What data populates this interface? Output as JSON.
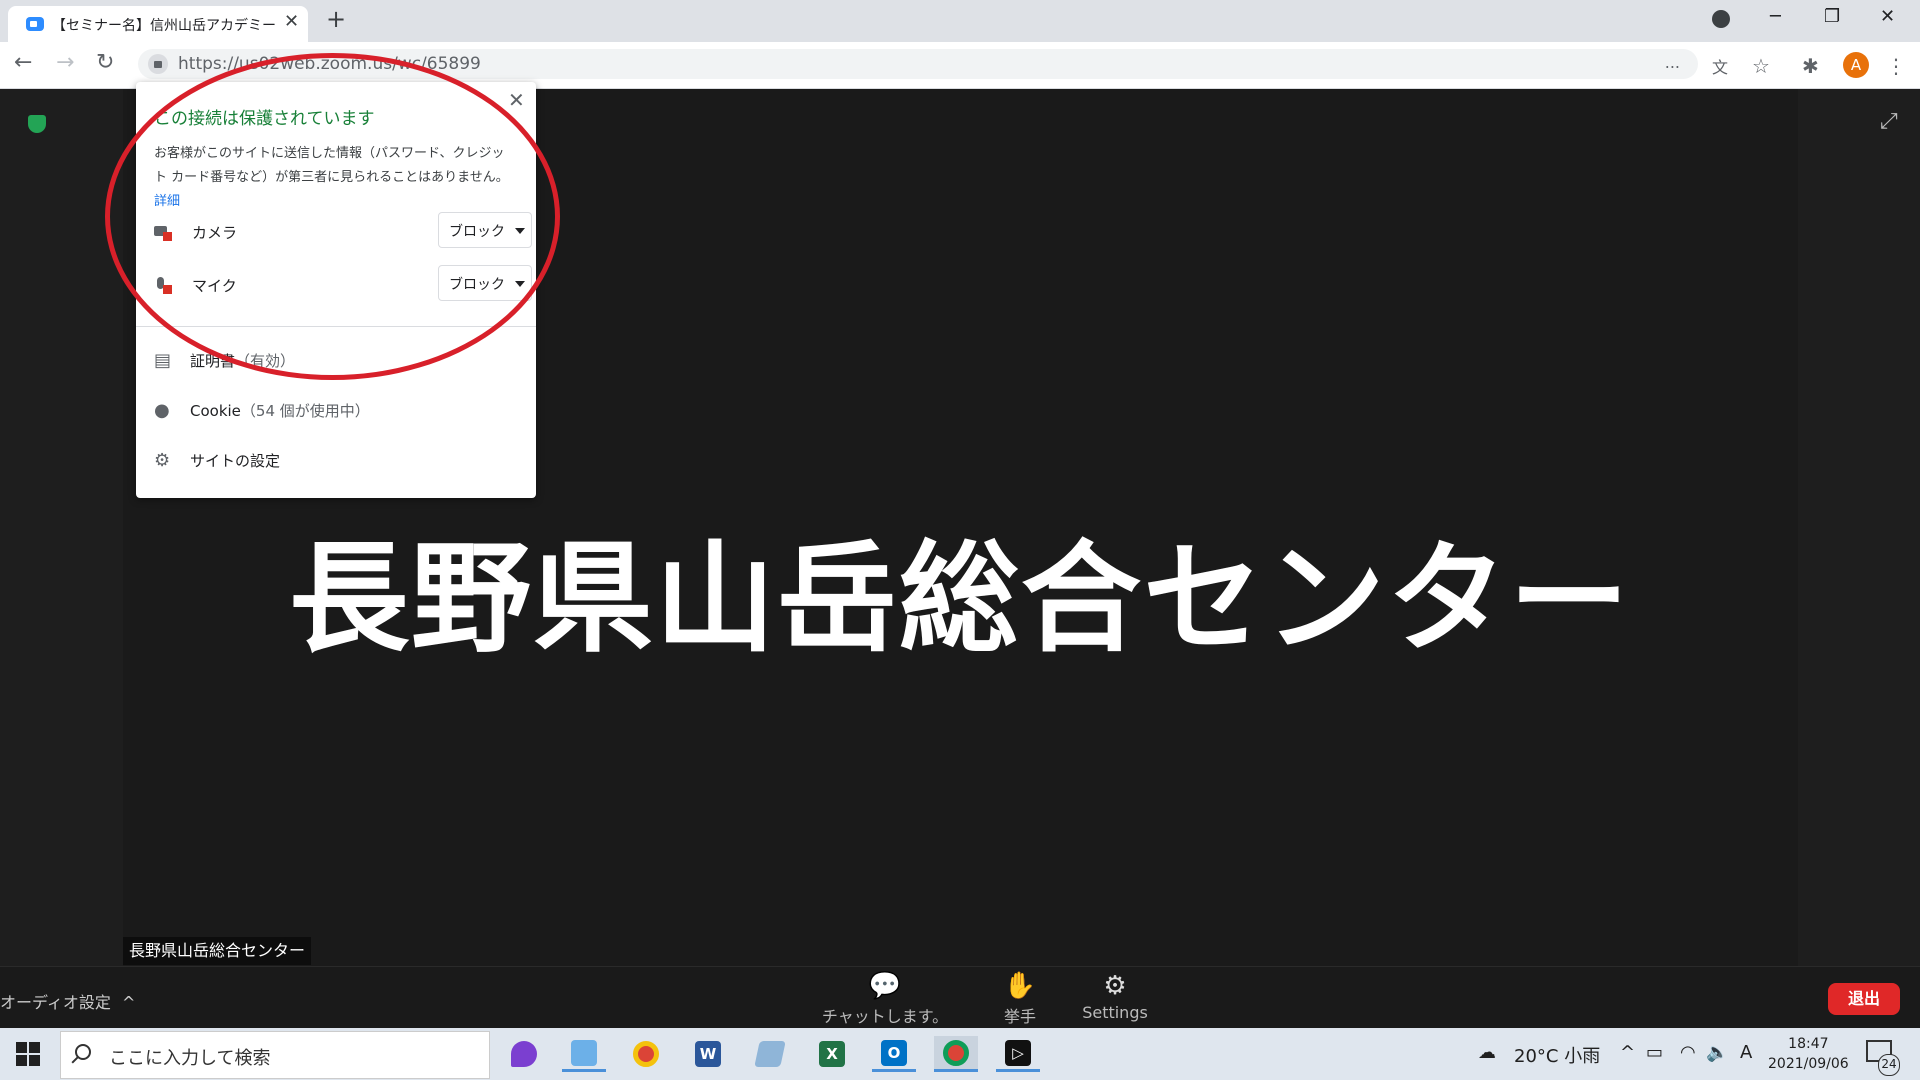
{
  "browser": {
    "tab_title": "【セミナー名】信州山岳アカデミー",
    "tab_close": "✕",
    "new_tab": "+",
    "url": "https://us02web.zoom.us/wc/65899",
    "url_ellipsis": "...",
    "profile_initial": "A",
    "window_controls": {
      "minimize": "─",
      "restore": "❐",
      "close": "✕"
    }
  },
  "site_info_popup": {
    "title": "この接続は保護されています",
    "description": "お客様がこのサイトに送信した情報（パスワード、クレジット カード番号など）が第三者に見られることはありません。",
    "detail_link": "詳細",
    "close": "✕",
    "permissions": [
      {
        "label": "カメラ",
        "value": "ブロック",
        "icon": "camera-blocked-icon"
      },
      {
        "label": "マイク",
        "value": "ブロック",
        "icon": "mic-blocked-icon"
      }
    ],
    "links": [
      {
        "label": "証明書",
        "sub": "（有効）",
        "icon": "certificate-icon"
      },
      {
        "label": "Cookie",
        "sub": "（54 個が使用中）",
        "icon": "cookie-icon"
      },
      {
        "label": "サイトの設定",
        "sub": "",
        "icon": "gear-icon"
      }
    ]
  },
  "zoom": {
    "main_title": "長野県山岳総合センター",
    "name_tag": "長野県山岳総合センター",
    "audio_settings": "オーディオ設定",
    "chat_label": "チャットします。",
    "raise_hand_label": "挙手",
    "settings_label": "Settings",
    "leave_label": "退出"
  },
  "taskbar": {
    "search_placeholder": "ここに入力して検索",
    "weather": "20°C 小雨",
    "ime": "A",
    "time": "18:47",
    "date": "2021/09/06",
    "notification_count": "24"
  },
  "colors": {
    "secure_green": "#188038",
    "link_blue": "#1a73e8",
    "leave_red": "#e02828",
    "annotation_red": "#d8202a",
    "zoom_blue": "#2d8cff"
  }
}
